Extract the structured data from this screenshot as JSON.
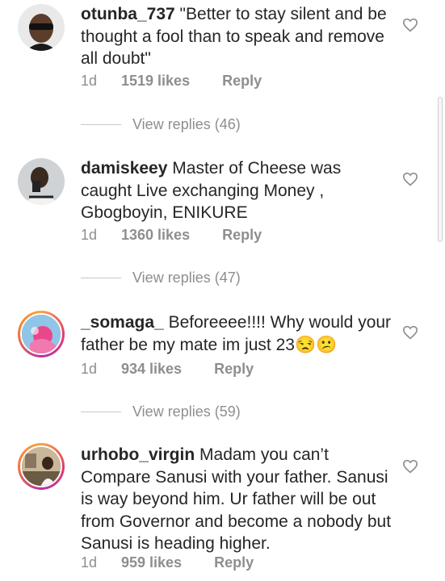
{
  "comments": [
    {
      "username": "otunba_737",
      "text": "\"Better to stay silent and be thought a fool than to speak and remove all doubt\"",
      "time": "1d",
      "likes": "1519 likes",
      "reply_label": "Reply",
      "view_replies": "View replies (46)"
    },
    {
      "username": "damiskeey",
      "text": "Master of Cheese was caught Live exchanging Money , Gbogboyin, ENIKURE",
      "time": "1d",
      "likes": "1360 likes",
      "reply_label": "Reply",
      "view_replies": "View replies (47)"
    },
    {
      "username": "_somaga_",
      "text": "Beforeeee!!!! Why would your father be my mate im just 23😒😕",
      "time": "1d",
      "likes": "934 likes",
      "reply_label": "Reply",
      "view_replies": "View replies (59)"
    },
    {
      "username": "urhobo_virgin",
      "text": "Madam you can’t Compare Sanusi with your father. Sanusi is way beyond him. Ur father will be out from Governor and become a nobody but Sanusi is heading higher.",
      "time": "1d",
      "likes": "959 likes",
      "reply_label": "Reply"
    }
  ],
  "icons": {
    "like": "heart-outline-icon",
    "avatar": "user-avatar"
  },
  "colors": {
    "text": "#262626",
    "secondary": "#8e8e8e",
    "story_ring": "#e33b6f"
  }
}
